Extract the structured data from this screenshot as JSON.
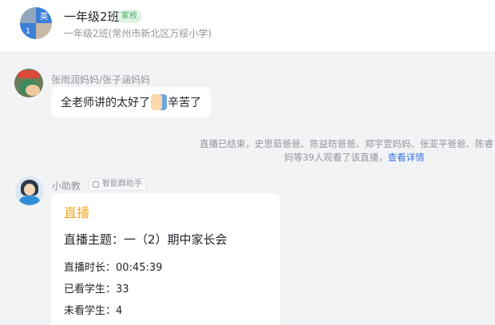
{
  "header": {
    "avatar_cells": [
      "",
      "英",
      "1",
      ""
    ],
    "title": "一年级2班",
    "badge": "家校",
    "subtitle": "一年级2班(常州市新北区万绥小学)"
  },
  "messages": {
    "parent": {
      "sender": "张雨润妈妈/张子涵妈妈",
      "text_before": "全老师讲的太好了",
      "emoji": "thumbs-up-icon",
      "text_after": "辛苦了"
    },
    "system_notice": {
      "line1": "直播已结束，史思茹爸爸、陈益昉爸爸、郑宇萱妈妈、张亚平爸爸、陈睿",
      "line2": "妈等39人观看了该直播，",
      "link": "查看详情"
    },
    "assistant": {
      "sender": "小助教",
      "tag": "智能群助手",
      "card": {
        "label": "直播",
        "topic": "直播主题：一（2）期中家长会",
        "duration": "直播时长：00:45:39",
        "watched": "已看学生：33",
        "unwatched": "未看学生：4"
      }
    }
  },
  "colors": {
    "background": "#f2f3f5",
    "link": "#3b74e8",
    "live_label": "#f5a623",
    "badge_green": "#3aa85a"
  }
}
